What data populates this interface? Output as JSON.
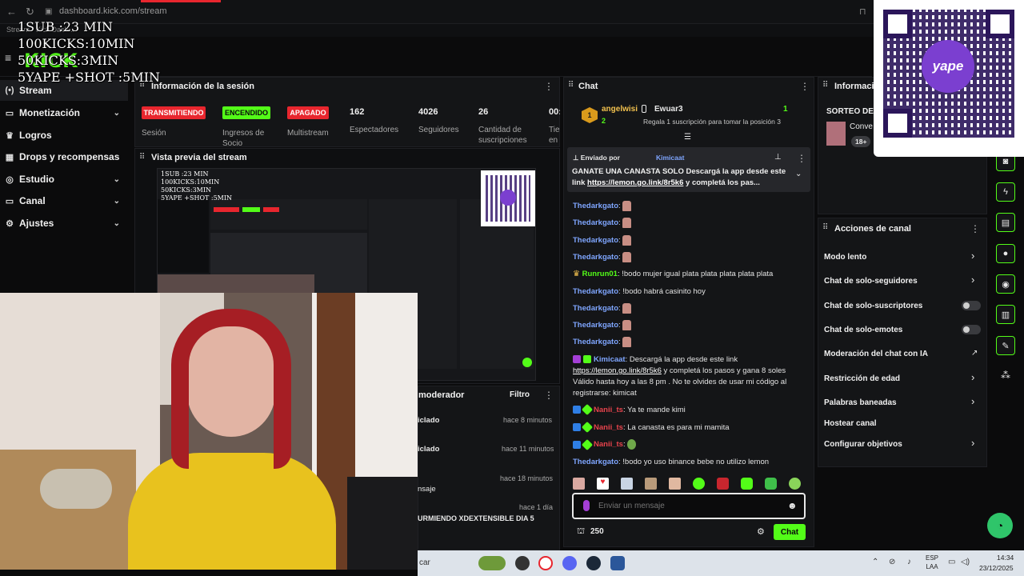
{
  "browser": {
    "url": "dashboard.kick.com/stream",
    "tab_label": "Stream - Kick Dash..."
  },
  "overlay_text": [
    "1SUB :23 MIN",
    "100KICKS:10MIN",
    "50KICKS:3MIN",
    "5YAPE +SHOT :5MIN"
  ],
  "brand": {
    "logo": "KICK",
    "accent": "#53fc18"
  },
  "sidebar": {
    "items": [
      {
        "label": "Stream",
        "icon": "broadcast-icon",
        "active": true
      },
      {
        "label": "Monetización",
        "icon": "money-icon",
        "chevron": true
      },
      {
        "label": "Logros",
        "icon": "trophy-icon"
      },
      {
        "label": "Drops y recompensas",
        "icon": "gift-icon"
      },
      {
        "label": "Estudio",
        "icon": "studio-icon",
        "chevron": true
      },
      {
        "label": "Canal",
        "icon": "channel-icon",
        "chevron": true
      },
      {
        "label": "Ajustes",
        "icon": "settings-icon",
        "chevron": true
      }
    ]
  },
  "session": {
    "title": "Información de la sesión",
    "badges": [
      {
        "text": "TRANSMITIENDO",
        "label": "Sesión",
        "color": "#e8262e"
      },
      {
        "text": "ENCENDIDO",
        "label": "Ingresos de Socio",
        "color": "#53fc18"
      },
      {
        "text": "APAGADO",
        "label": "Multistream",
        "color": "#e8262e"
      }
    ],
    "stats": [
      {
        "value": "162",
        "label": "Espectadores"
      },
      {
        "value": "4026",
        "label": "Seguidores"
      },
      {
        "value": "26",
        "label": "Cantidad de suscripciones"
      },
      {
        "value": "00:",
        "label": "Tie en"
      }
    ]
  },
  "preview": {
    "title": "Vista previa del stream"
  },
  "moderator": {
    "title": "moderador",
    "filter": "Filtro",
    "rows": [
      {
        "text": "iclado",
        "time": "hace 8 minutos"
      },
      {
        "text": "iclado",
        "time": "hace 11 minutos"
      },
      {
        "text": "nsaje",
        "time": "hace 18 minutos"
      },
      {
        "text": "URMIENDO XDEXTENSIBLE DIA 5",
        "time": "hace 1 día"
      }
    ]
  },
  "chat": {
    "title": "Chat",
    "leaderboard": {
      "rank": "1",
      "user1": "angelwisi",
      "count1": "2",
      "user2": "Ewuar3",
      "count2": "1",
      "subtext": "Regala 1 suscripción para tomar la posición 3"
    },
    "pinned": {
      "sent_by_label": "Enviado por",
      "sender": "Kimicaat",
      "text": "GANATE UNA CANASTA SOLO Descargá la app desde este link",
      "link": "https://lemon.go.link/8r5k6",
      "tail": "y completá los pas..."
    },
    "messages": [
      {
        "user": "Thedarkgato",
        "text": "",
        "emote": true
      },
      {
        "user": "Thedarkgato",
        "text": "",
        "emote": true
      },
      {
        "user": "Thedarkgato",
        "text": "",
        "emote": true
      },
      {
        "user": "Thedarkgato",
        "text": "",
        "emote": true
      },
      {
        "user": "Runrun01",
        "text": "!bodo mujer igual plata plata plata plata plata"
      },
      {
        "user": "Thedarkgato",
        "text": "!bodo habrá casinito hoy"
      },
      {
        "user": "Thedarkgato",
        "text": "",
        "emote": true
      },
      {
        "user": "Thedarkgato",
        "text": "",
        "emote": true
      },
      {
        "user": "Thedarkgato",
        "text": "",
        "emote": true
      }
    ],
    "kimi_message": {
      "user": "Kimicaat",
      "text1": "Descargá la app desde este link",
      "link": "https://lemon.go.link/8r5k6",
      "text2": "y completá los pasos y gana 8 soles Válido hasta hoy a las 8 pm . No te olvides de usar mi código al registrarse: kimicat"
    },
    "late_messages": [
      {
        "user": "Nanii_ts",
        "text": "Ya te mande kimi"
      },
      {
        "user": "Nanii_ts",
        "text": "La canasta es para mi mamita"
      },
      {
        "user": "Nanii_ts",
        "text": ""
      },
      {
        "user": "Thedarkgato",
        "text": "!bodo yo uso binance bebe no utilizo lemon"
      }
    ],
    "input_placeholder": "Enviar un mensaje",
    "points": "250",
    "send_label": "Chat"
  },
  "info_panel": {
    "title": "Informació",
    "raffle": "SORTEO DE",
    "item": "Conve",
    "age_badge": "18+"
  },
  "channel_actions": {
    "title": "Acciones de canal",
    "items": [
      {
        "label": "Modo lento",
        "control": "chevron"
      },
      {
        "label": "Chat de solo-seguidores",
        "control": "chevron"
      },
      {
        "label": "Chat de solo-suscriptores",
        "control": "toggle"
      },
      {
        "label": "Chat de solo-emotes",
        "control": "toggle"
      },
      {
        "label": "Moderación del chat con IA",
        "control": "external"
      },
      {
        "label": "Restricción de edad",
        "control": "chevron"
      },
      {
        "label": "Palabras baneadas",
        "control": "chevron"
      },
      {
        "label": "Hostear canal",
        "control": "none"
      },
      {
        "label": "Configurar objetivos",
        "control": "chevron"
      }
    ]
  },
  "qr": {
    "brand": "yape"
  },
  "taskbar": {
    "search": "car",
    "lang1": "ESP",
    "lang2": "LAA",
    "time": "14:34",
    "date": "23/12/2025"
  }
}
